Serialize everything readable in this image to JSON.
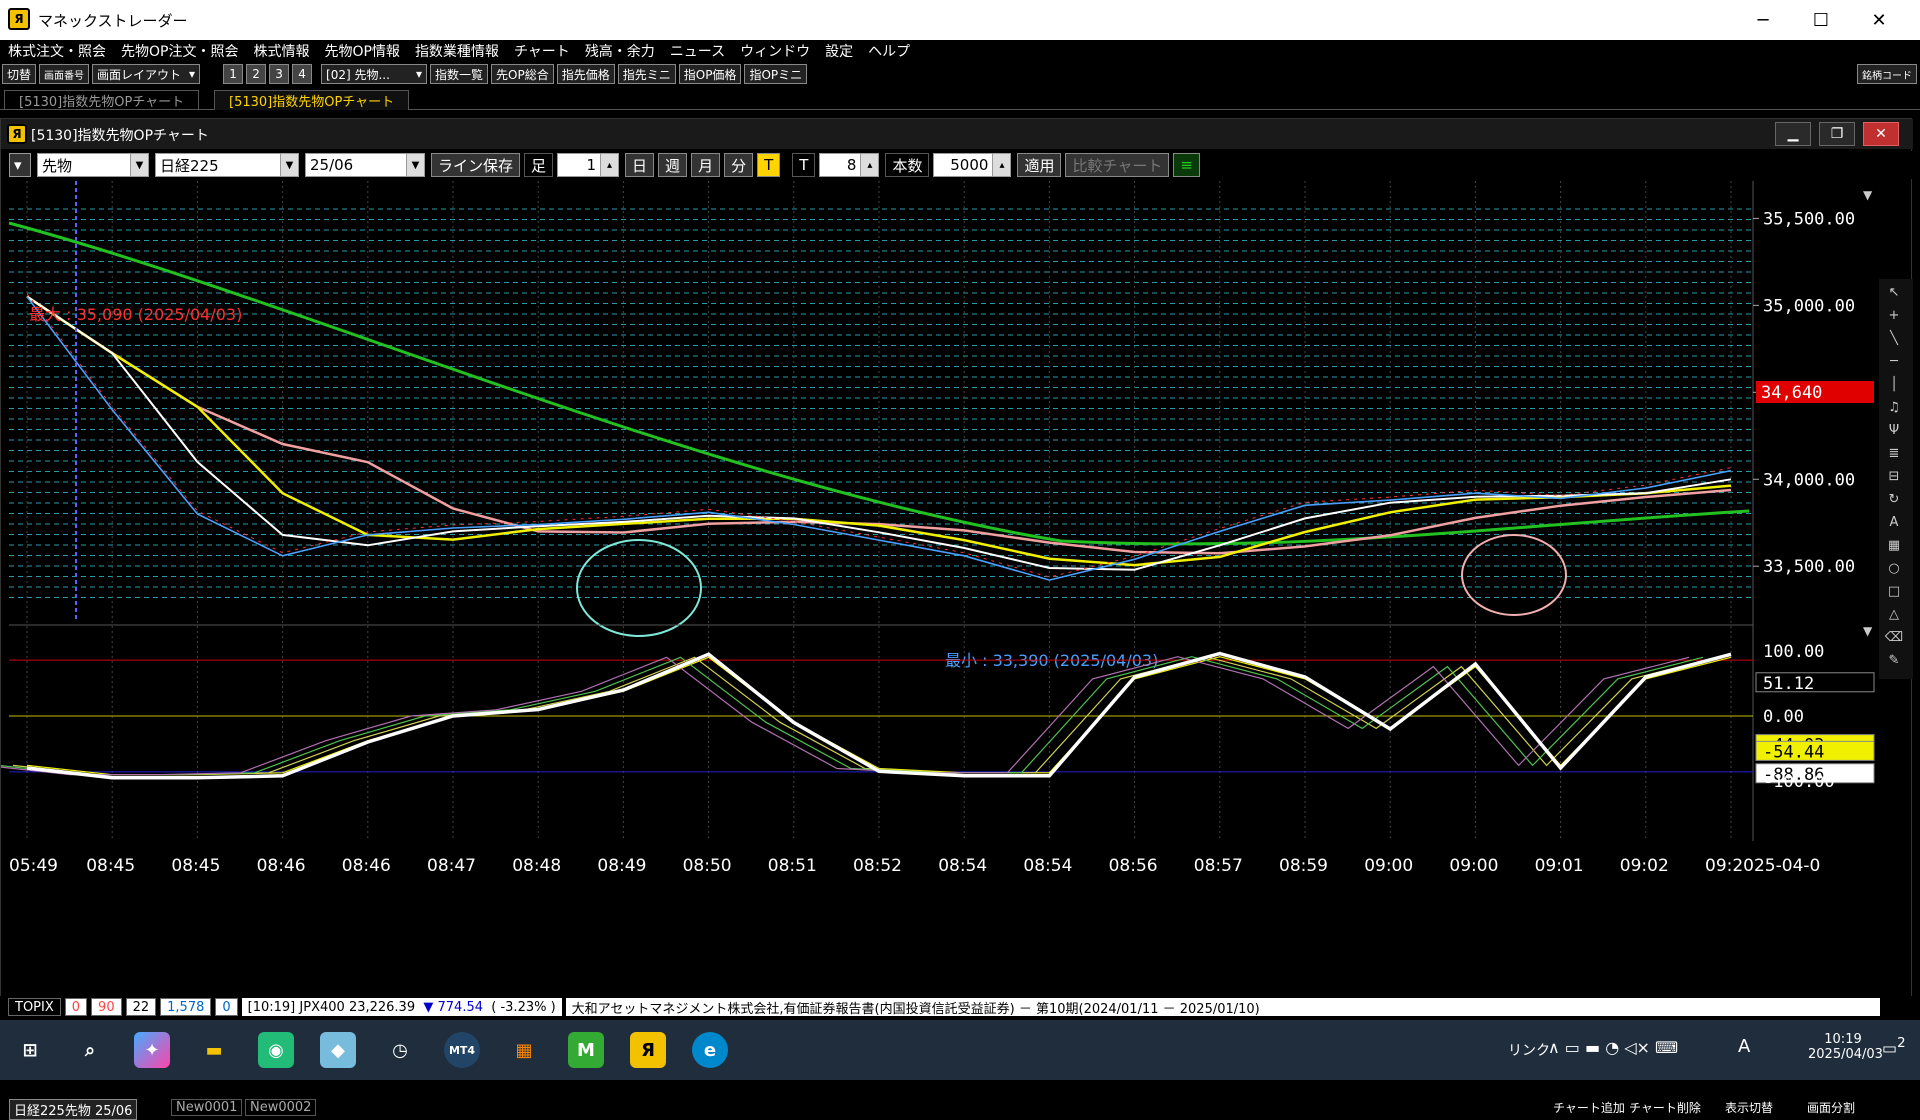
{
  "window": {
    "title": "マネックストレーダー",
    "minimize": "─",
    "maximize": "☐",
    "close": "✕"
  },
  "menu": [
    "株式注文・照会",
    "先物OP注文・照会",
    "株式情報",
    "先物OP情報",
    "指数業種情報",
    "チャート",
    "残高・余力",
    "ニュース",
    "ウィンドウ",
    "設定",
    "ヘルプ"
  ],
  "toolbar": {
    "switch": "切替",
    "screen_no": "画面番号",
    "layout": "画面レイアウト",
    "pages": [
      "1",
      "2",
      "3",
      "4"
    ],
    "preset": "[02] 先物...",
    "buttons": [
      "指数一覧",
      "先OP総合",
      "指先価格",
      "指先ミニ",
      "指OP価格",
      "指OPミニ"
    ],
    "code": "銘柄コード"
  },
  "tabs": [
    "[5130]指数先物OPチャート",
    "[5130]指数先物OPチャート"
  ],
  "chart_window": {
    "title": "[5130]指数先物OPチャート",
    "controls": {
      "kind": "先物",
      "index": "日経225",
      "month": "25/06",
      "line_save": "ライン保存",
      "ashi": "足",
      "ashi_value": "1",
      "day": "日",
      "week": "週",
      "month_btn": "月",
      "minute": "分",
      "tick_T": "T",
      "T_label": "T",
      "T_value": "8",
      "count_label": "本数",
      "count_value": "5000",
      "apply": "適用",
      "compare": "比較チャート"
    },
    "max_label": "最大 : 35,090 (2025/04/03)",
    "min_label": "最小 : 33,390 (2025/04/03)",
    "price_axis": [
      "35,500.00",
      "35,000.00",
      "34,500.00",
      "34,000.00",
      "33,500.00"
    ],
    "current_price": "34,640",
    "osc_axis": [
      "100.00",
      "51.12",
      "0.00",
      "-44.03",
      "-54.44",
      "-88.86",
      "-100.00"
    ],
    "time_axis": [
      "05:49",
      "08:45",
      "08:45",
      "08:46",
      "08:46",
      "08:47",
      "08:48",
      "08:49",
      "08:50",
      "08:51",
      "08:52",
      "08:54",
      "08:54",
      "08:56",
      "08:57",
      "08:59",
      "09:00",
      "09:00",
      "09:01",
      "09:02",
      "09:2025-04-0"
    ],
    "bottom_tabs": [
      "日経225先物 25/06",
      "New0001",
      "New0002"
    ],
    "bottom_right": [
      "チャート追加",
      "チャート削除",
      "表示切替",
      "画面分割"
    ]
  },
  "chart_data": {
    "type": "line",
    "x": [
      "05:49",
      "08:45",
      "08:45",
      "08:46",
      "08:46",
      "08:47",
      "08:48",
      "08:49",
      "08:50",
      "08:51",
      "08:52",
      "08:54",
      "08:54",
      "08:56",
      "08:57",
      "08:59",
      "09:00",
      "09:00",
      "09:01",
      "09:02",
      "09:2025-04-0"
    ],
    "series": [
      {
        "values": [
          35050,
          34400,
          33800,
          33560,
          33680,
          33720,
          33740,
          33770,
          33810,
          33740,
          33650,
          33560,
          33420,
          33540,
          33700,
          33850,
          33880,
          33920,
          33890,
          33950,
          34050
        ]
      }
    ],
    "ylim": [
      33300,
      35600
    ],
    "max_value": 35090,
    "min_value": 33390
  },
  "ticker": {
    "label": "TOPIX",
    "v1": "0",
    "v2": "90",
    "v3": "22",
    "v4": "1,578",
    "v5": "0",
    "time": "[10:19]",
    "name": "JPX400",
    "price": "23,226.39",
    "change": "▼ 774.54",
    "pct": "( -3.23% )",
    "news": "大和アセットマネジメント株式会社,有価証券報告書(内国投資信託受益証券) － 第10期(2024/01/11 － 2025/01/10)"
  },
  "taskbar": {
    "link": "リンク",
    "ime": "A",
    "time": "10:19",
    "date": "2025/04/03",
    "notif": "2"
  },
  "colors": {
    "ma_green": "#22c020",
    "ma_pink": "#f0a0a0",
    "ma_yellow": "#f0f000",
    "price_blue": "#4aa0ff",
    "price_red": "#ff3030",
    "accent": "#ffd400"
  }
}
